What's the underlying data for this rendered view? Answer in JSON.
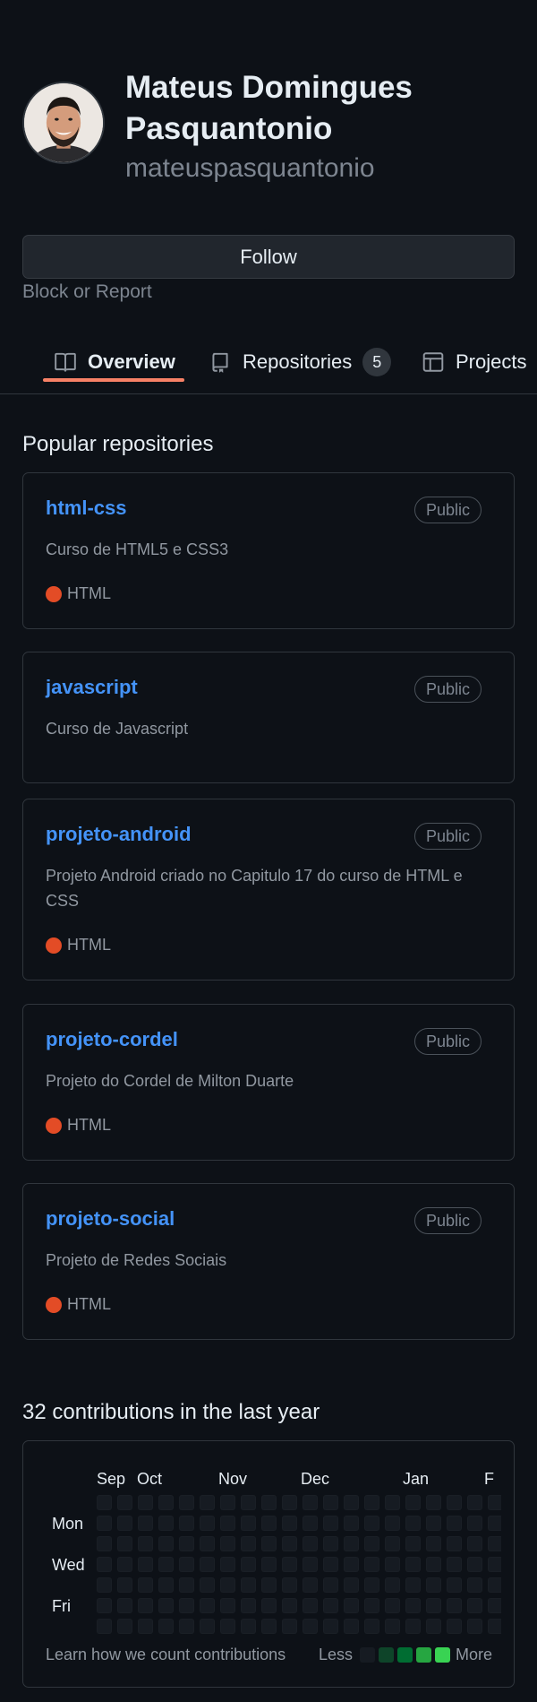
{
  "profile": {
    "fullname": "Mateus Domingues Pasquantonio",
    "username": "mateuspasquantonio"
  },
  "actions": {
    "follow_label": "Follow",
    "block_label": "Block or Report"
  },
  "tabs": [
    {
      "label": "Overview",
      "icon": "book-icon",
      "selected": true
    },
    {
      "label": "Repositories",
      "icon": "repo-icon",
      "count": "5"
    },
    {
      "label": "Projects",
      "icon": "table-icon"
    }
  ],
  "popular": {
    "title": "Popular repositories",
    "repos": [
      {
        "name": "html-css",
        "visibility": "Public",
        "description": "Curso de HTML5 e CSS3",
        "language": "HTML"
      },
      {
        "name": "javascript",
        "visibility": "Public",
        "description": "Curso de Javascript"
      },
      {
        "name": "projeto-android",
        "visibility": "Public",
        "description": "Projeto Android criado no Capitulo 17 do curso de HTML e CSS",
        "language": "HTML"
      },
      {
        "name": "projeto-cordel",
        "visibility": "Public",
        "description": "Projeto do Cordel de Milton Duarte",
        "language": "HTML"
      },
      {
        "name": "projeto-social",
        "visibility": "Public",
        "description": "Projeto de Redes Sociais",
        "language": "HTML"
      }
    ]
  },
  "contributions": {
    "title": "32 contributions in the last year",
    "months": [
      "Sep",
      "Oct",
      "Nov",
      "Dec",
      "Jan",
      "F"
    ],
    "days": [
      "Mon",
      "Wed",
      "Fri"
    ],
    "learn_link": "Learn how we count contributions",
    "legend_less": "Less",
    "legend_more": "More",
    "legend_colors": [
      "#161b22",
      "#0e4429",
      "#006d32",
      "#26a641",
      "#39d353"
    ]
  },
  "colors": {
    "accent_link": "#4493f8",
    "tab_underline": "#f78166",
    "html_language": "#e34c26"
  }
}
